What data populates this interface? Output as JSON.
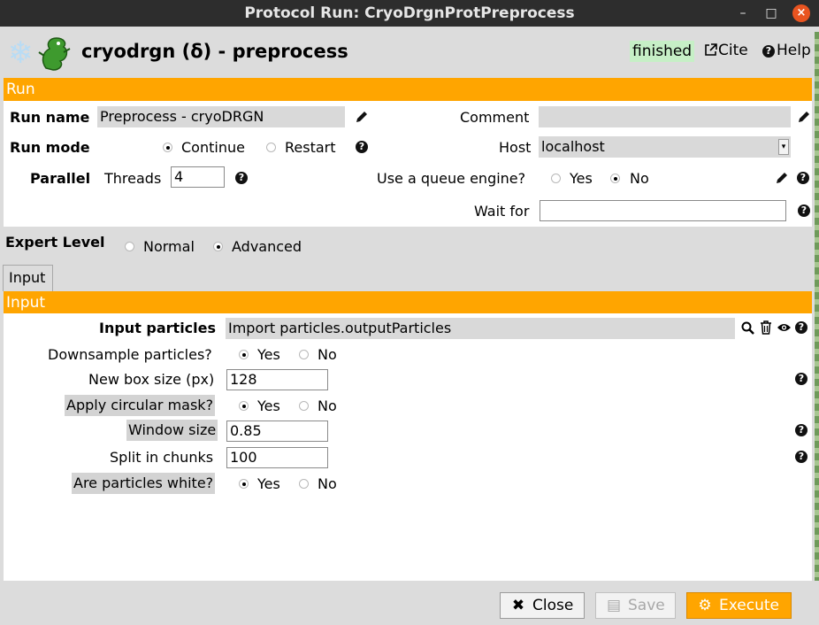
{
  "window": {
    "title": "Protocol Run: CryoDrgnProtPreprocess",
    "minimize": "–",
    "maximize": "□",
    "close": "×"
  },
  "header": {
    "title": "cryodrgn (δ) - preprocess",
    "status": "finished",
    "cite_label": "Cite",
    "help_label": "Help",
    "icons": [
      "snowflake-logo",
      "dragon-logo"
    ]
  },
  "run_section": {
    "title": "Run",
    "run_name_label": "Run name",
    "run_name_value": "Preprocess - cryoDRGN",
    "comment_label": "Comment",
    "comment_value": "",
    "run_mode_label": "Run mode",
    "run_mode_options": [
      "Continue",
      "Restart"
    ],
    "run_mode_selected": "Continue",
    "host_label": "Host",
    "host_value": "localhost",
    "parallel_label": "Parallel",
    "threads_label": "Threads",
    "threads_value": "4",
    "queue_label": "Use a queue engine?",
    "queue_options": [
      "Yes",
      "No"
    ],
    "queue_selected": "No",
    "wait_for_label": "Wait for",
    "wait_for_value": ""
  },
  "expert": {
    "label": "Expert Level",
    "options": [
      "Normal",
      "Advanced"
    ],
    "selected": "Advanced"
  },
  "tabs": [
    {
      "label": "Input",
      "active": true
    }
  ],
  "input_section": {
    "title": "Input",
    "input_particles_label": "Input particles",
    "input_particles_value": "Import particles.outputParticles",
    "downsample_label": "Downsample particles?",
    "downsample_options": [
      "Yes",
      "No"
    ],
    "downsample_selected": "Yes",
    "box_size_label": "New box size (px)",
    "box_size_value": "128",
    "mask_label": "Apply circular mask?",
    "mask_options": [
      "Yes",
      "No"
    ],
    "mask_selected": "Yes",
    "window_size_label": "Window size",
    "window_size_value": "0.85",
    "chunks_label": "Split in chunks",
    "chunks_value": "100",
    "white_label": "Are particles white?",
    "white_options": [
      "Yes",
      "No"
    ],
    "white_selected": "Yes"
  },
  "buttons": {
    "close": "Close",
    "save": "Save",
    "execute": "Execute"
  },
  "colors": {
    "section_bar": "#ffa500",
    "status_bg": "#c6efc6",
    "titlebar": "#2d2d2d",
    "close_window": "#e95420"
  }
}
